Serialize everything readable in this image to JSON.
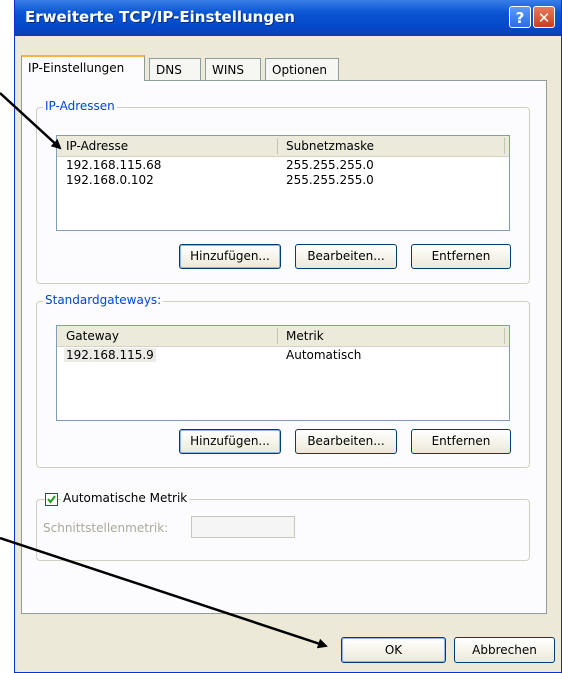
{
  "window": {
    "title": "Erweiterte TCP/IP-Einstellungen",
    "help_label": "?",
    "close_label": "✕"
  },
  "tabs": [
    "IP-Einstellungen",
    "DNS",
    "WINS",
    "Optionen"
  ],
  "ip_group": {
    "legend": "IP-Adressen",
    "columns": [
      "IP-Adresse",
      "Subnetzmaske"
    ],
    "rows": [
      [
        "192.168.115.68",
        "255.255.255.0"
      ],
      [
        "192.168.0.102",
        "255.255.255.0"
      ]
    ],
    "buttons": {
      "add": "Hinzufügen...",
      "edit": "Bearbeiten...",
      "remove": "Entfernen"
    }
  },
  "gateway_group": {
    "legend": "Standardgateways:",
    "columns": [
      "Gateway",
      "Metrik"
    ],
    "rows": [
      [
        "192.168.115.9",
        "Automatisch"
      ]
    ],
    "buttons": {
      "add": "Hinzufügen...",
      "edit": "Bearbeiten...",
      "remove": "Entfernen"
    }
  },
  "metric_group": {
    "checkbox_label": "Automatische Metrik",
    "checked": true,
    "interface_metric_label": "Schnittstellenmetrik:",
    "interface_metric_value": ""
  },
  "footer": {
    "ok": "OK",
    "cancel": "Abbrechen"
  },
  "colors": {
    "titlebar": "#0a56d4",
    "dialog_bg": "#ece9d8",
    "legend_text": "#0046d5",
    "arrow": "#000000"
  }
}
